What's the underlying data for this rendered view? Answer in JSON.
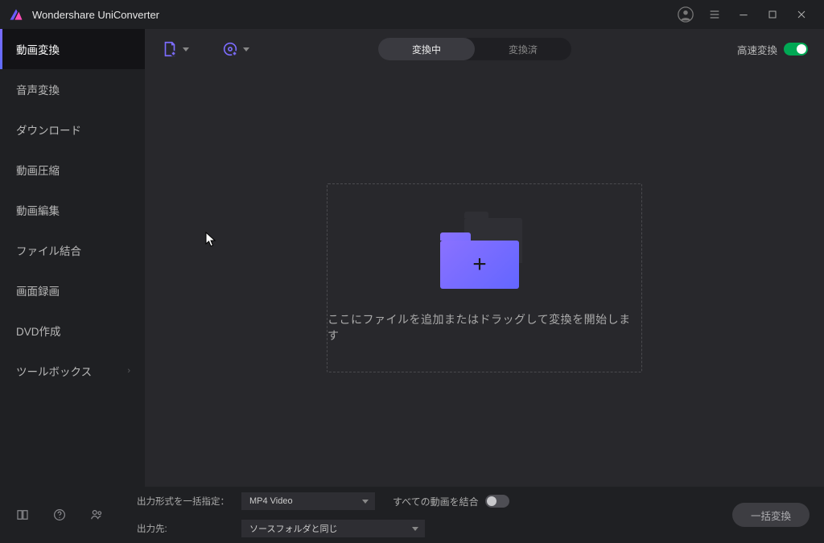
{
  "app": {
    "title": "Wondershare UniConverter"
  },
  "sidebar": {
    "items": [
      {
        "label": "動画変換"
      },
      {
        "label": "音声変換"
      },
      {
        "label": "ダウンロード"
      },
      {
        "label": "動画圧縮"
      },
      {
        "label": "動画編集"
      },
      {
        "label": "ファイル結合"
      },
      {
        "label": "画面録画"
      },
      {
        "label": "DVD作成"
      },
      {
        "label": "ツールボックス"
      }
    ]
  },
  "toolbar": {
    "segment": {
      "converting": "変換中",
      "converted": "変換済"
    },
    "speed_label": "高速変換"
  },
  "drop": {
    "text": "ここにファイルを追加またはドラッグして変換を開始します"
  },
  "bottom": {
    "format_label": "出力形式を一括指定：",
    "format_value": "MP4 Video",
    "dest_label": "出力先:",
    "dest_value": "ソースフォルダと同じ",
    "merge_label": "すべての動画を結合",
    "convert_button": "一括変換"
  }
}
